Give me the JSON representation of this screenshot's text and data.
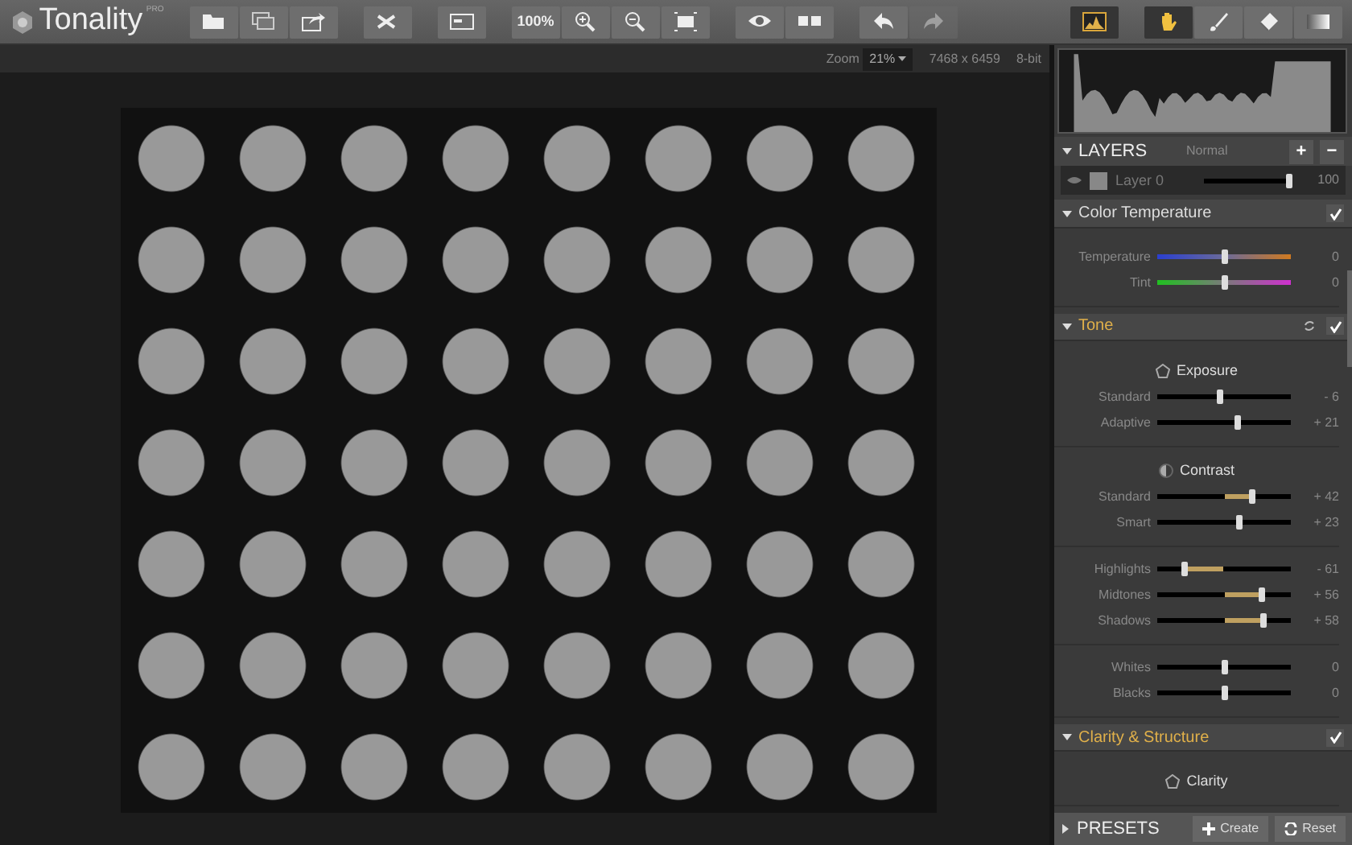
{
  "app": {
    "name": "Tonality",
    "badge": "PRO"
  },
  "toolbar": [
    {
      "group": [
        {
          "selected": false,
          "disabled": false
        },
        {
          "selected": false,
          "disabled": false
        },
        {
          "selected": false,
          "disabled": false
        }
      ]
    },
    {
      "group": [
        {
          "selected": false,
          "disabled": false
        }
      ]
    },
    {
      "group": [
        {
          "selected": false,
          "disabled": false
        }
      ]
    },
    {
      "group": [
        {
          "label": "100%",
          "selected": false,
          "disabled": false
        },
        {
          "selected": false,
          "disabled": false
        },
        {
          "selected": false,
          "disabled": false
        },
        {
          "selected": false,
          "disabled": false
        }
      ]
    },
    {
      "group": [
        {
          "selected": false,
          "disabled": false
        },
        {
          "selected": false,
          "disabled": false
        }
      ]
    },
    {
      "group": [
        {
          "selected": false,
          "disabled": false
        },
        {
          "selected": false,
          "disabled": true
        }
      ]
    },
    {
      "group": [
        {
          "selected": true,
          "disabled": false
        }
      ]
    },
    {
      "group": [
        {
          "selected": true,
          "disabled": false
        },
        {
          "selected": false,
          "disabled": false
        },
        {
          "selected": false,
          "disabled": false
        },
        {
          "selected": false,
          "disabled": false
        }
      ]
    }
  ],
  "info_bar": {
    "zoom_label": "Zoom",
    "zoom_value": "21%",
    "dimensions": "7468 x 6459",
    "bit_depth": "8-bit"
  },
  "layers": {
    "title": "LAYERS",
    "blend_mode": "Normal",
    "add": "+",
    "remove": "−",
    "rows": [
      {
        "name": "Layer 0",
        "visible": true,
        "level": 1.0,
        "opacity": "100"
      }
    ]
  },
  "panels": [
    {
      "title": "Color Temperature",
      "expanded": true,
      "active": false,
      "checked": true,
      "resettable": false,
      "groups": [
        {
          "sliders": [
            {
              "label": "Temperature",
              "kind": "temperature",
              "level": 0.5,
              "reading": "0"
            },
            {
              "label": "Tint",
              "kind": "tint",
              "level": 0.5,
              "reading": "0"
            }
          ]
        }
      ]
    },
    {
      "title": "Tone",
      "expanded": true,
      "active": true,
      "checked": true,
      "resettable": true,
      "groups": [
        {
          "title": "Exposure",
          "sliders": [
            {
              "label": "Standard",
              "kind": "plain",
              "level": 0.47,
              "reading": "- 6"
            },
            {
              "label": "Adaptive",
              "kind": "plain",
              "level": 0.6,
              "reading": "+ 21"
            }
          ]
        },
        {
          "title": "Contrast",
          "sliders": [
            {
              "label": "Standard",
              "kind": "filled",
              "level": 0.71,
              "reading": "+ 42"
            },
            {
              "label": "Smart",
              "kind": "plain",
              "level": 0.61,
              "reading": "+ 23"
            }
          ]
        },
        {
          "sliders": [
            {
              "label": "Highlights",
              "kind": "filled",
              "level": 0.2,
              "reading": "- 61"
            },
            {
              "label": "Midtones",
              "kind": "filled",
              "level": 0.78,
              "reading": "+ 56"
            },
            {
              "label": "Shadows",
              "kind": "filled",
              "level": 0.79,
              "reading": "+ 58"
            }
          ]
        },
        {
          "sliders": [
            {
              "label": "Whites",
              "kind": "plain",
              "level": 0.5,
              "reading": "0"
            },
            {
              "label": "Blacks",
              "kind": "plain",
              "level": 0.5,
              "reading": "0"
            }
          ]
        }
      ]
    },
    {
      "title": "Clarity & Structure",
      "expanded": true,
      "active": true,
      "checked": true,
      "resettable": false,
      "groups": [
        {
          "title": "Clarity"
        }
      ]
    }
  ],
  "presets": {
    "title": "PRESETS",
    "expanded": false,
    "buttons": [
      "Create",
      "Reset"
    ]
  }
}
